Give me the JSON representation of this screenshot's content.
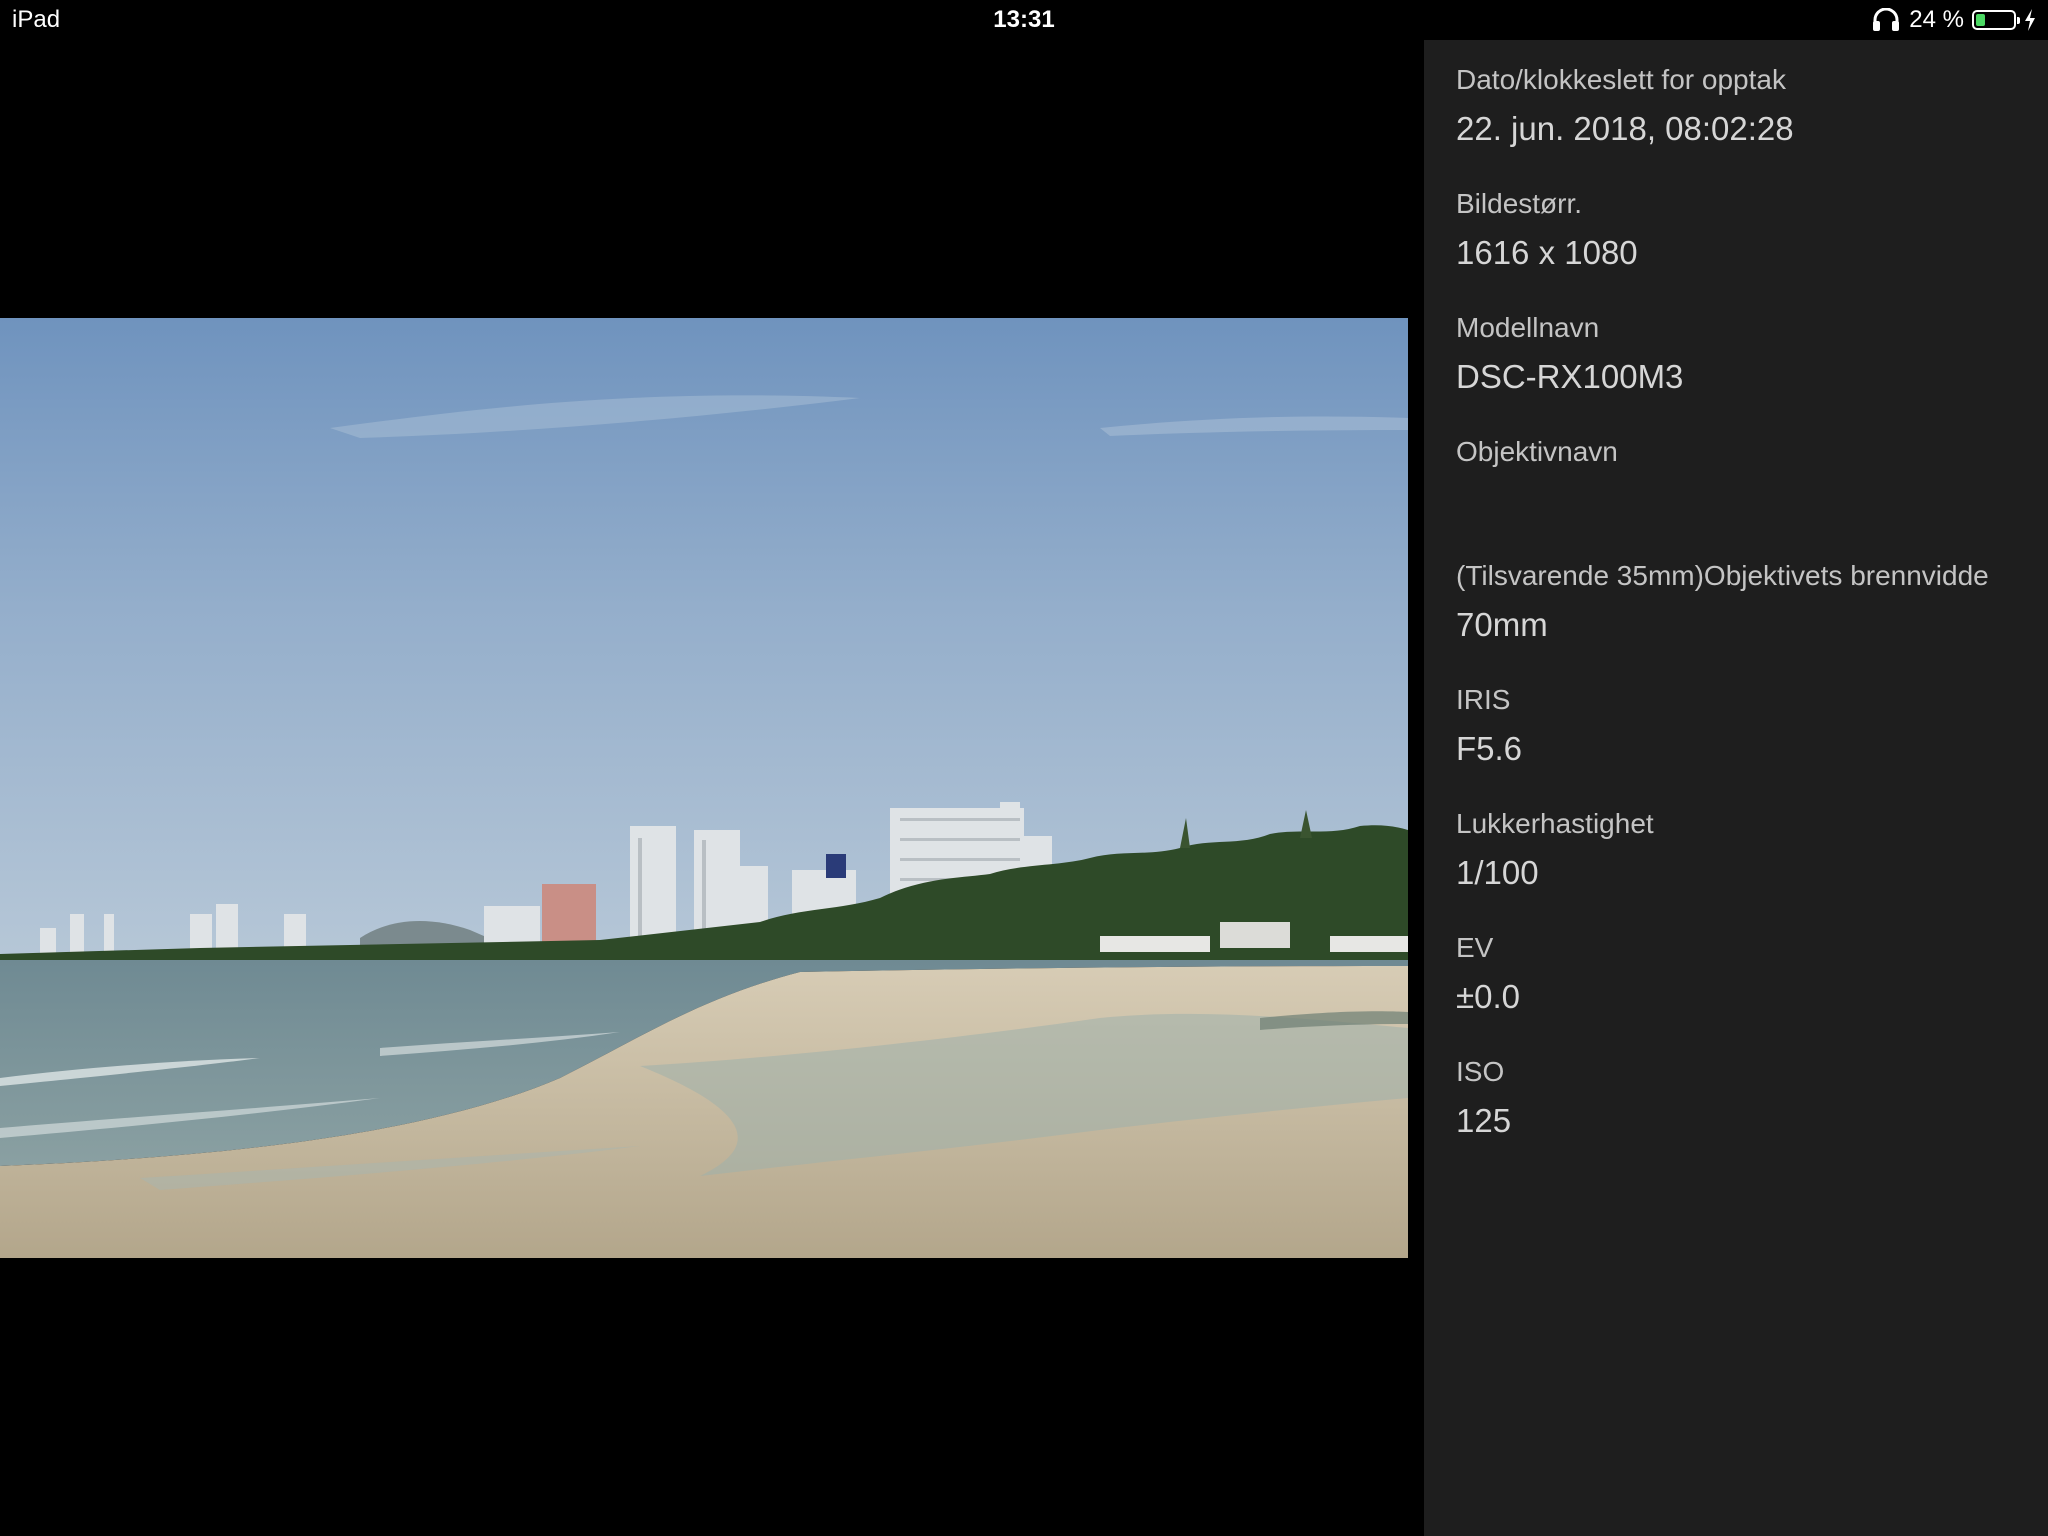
{
  "status_bar": {
    "device": "iPad",
    "time": "13:31",
    "battery_percent": "24 %",
    "battery_level": 0.24,
    "battery_color": "#4cd964",
    "icons": [
      "headphones-icon",
      "battery-icon",
      "charging-icon"
    ]
  },
  "photo": {
    "subject": "beach-with-city-skyline"
  },
  "info_panel": {
    "background": "#1e1e1e",
    "items": [
      {
        "label": "Dato/klokkeslett for opptak",
        "value": "22. jun. 2018, 08:02:28"
      },
      {
        "label": "Bildestørr.",
        "value": "1616 x 1080"
      },
      {
        "label": "Modellnavn",
        "value": "DSC-RX100M3"
      },
      {
        "label": "Objektivnavn",
        "value": ""
      },
      {
        "label": "(Tilsvarende 35mm)Objektivets brennvidde",
        "value": "70mm"
      },
      {
        "label": "IRIS",
        "value": "F5.6"
      },
      {
        "label": "Lukkerhastighet",
        "value": "1/100"
      },
      {
        "label": "EV",
        "value": "±0.0"
      },
      {
        "label": "ISO",
        "value": "125"
      }
    ]
  }
}
